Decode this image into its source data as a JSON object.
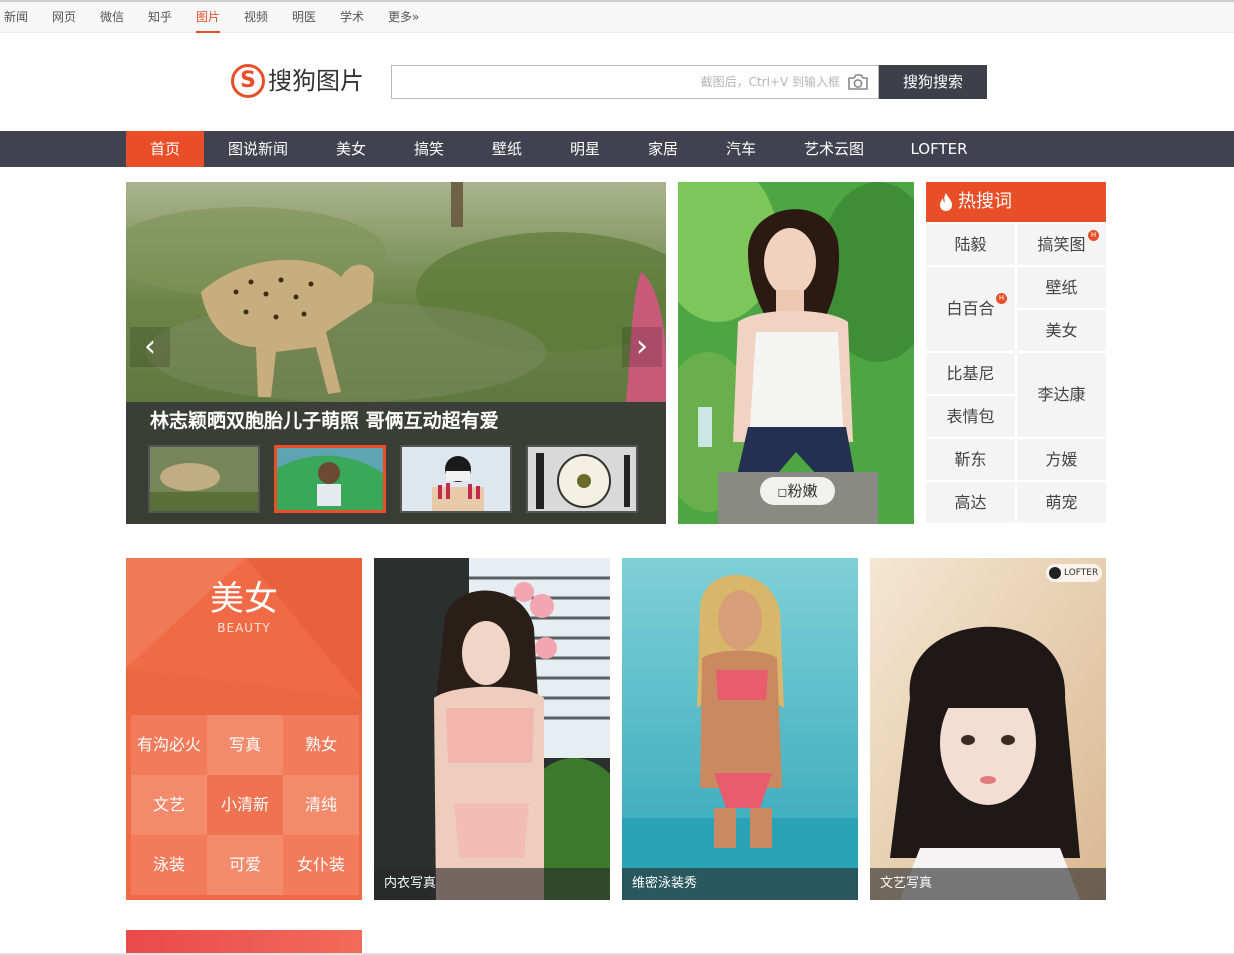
{
  "topbar": {
    "channels": [
      "新闻",
      "网页",
      "微信",
      "知乎",
      "图片",
      "视频",
      "明医",
      "学术",
      "更多»"
    ],
    "active": "图片"
  },
  "brand": {
    "mark": "S",
    "name": "搜狗图片",
    "accent": "#e84f29"
  },
  "search": {
    "placeholder": "",
    "hint": "截图后，Ctrl+V 到输入框",
    "button": "搜狗搜索",
    "camera_icon": "camera-icon"
  },
  "nav": {
    "items": [
      "首页",
      "图说新闻",
      "美女",
      "搞笑",
      "壁纸",
      "明星",
      "家居",
      "汽车",
      "艺术云图",
      "LOFTER"
    ],
    "active": "首页"
  },
  "carousel": {
    "title": "林志颖晒双胞胎儿子萌照 哥俩互动超有爱",
    "prev_icon": "chevron-left-icon",
    "next_icon": "chevron-right-icon",
    "active_thumb": 2,
    "thumb_count": 4
  },
  "featured": {
    "tag": "粉嫩"
  },
  "hot": {
    "title": "热搜词",
    "icon": "fire-icon",
    "terms": [
      "陆毅",
      "搞笑图",
      "白百合",
      "壁纸",
      "美女",
      "比基尼",
      "李达康",
      "表情包",
      "靳东",
      "方媛",
      "高达",
      "萌宠"
    ],
    "badge": "H"
  },
  "category": {
    "title": "美女",
    "subtitle": "BEAUTY",
    "tags": [
      "有沟必火",
      "写真",
      "熟女",
      "文艺",
      "小清新",
      "清纯",
      "泳装",
      "可爱",
      "女仆装"
    ]
  },
  "photos": {
    "captions": [
      "内衣写真",
      "维密泳装秀",
      "文艺写真"
    ],
    "lofter": "LOFTER"
  }
}
